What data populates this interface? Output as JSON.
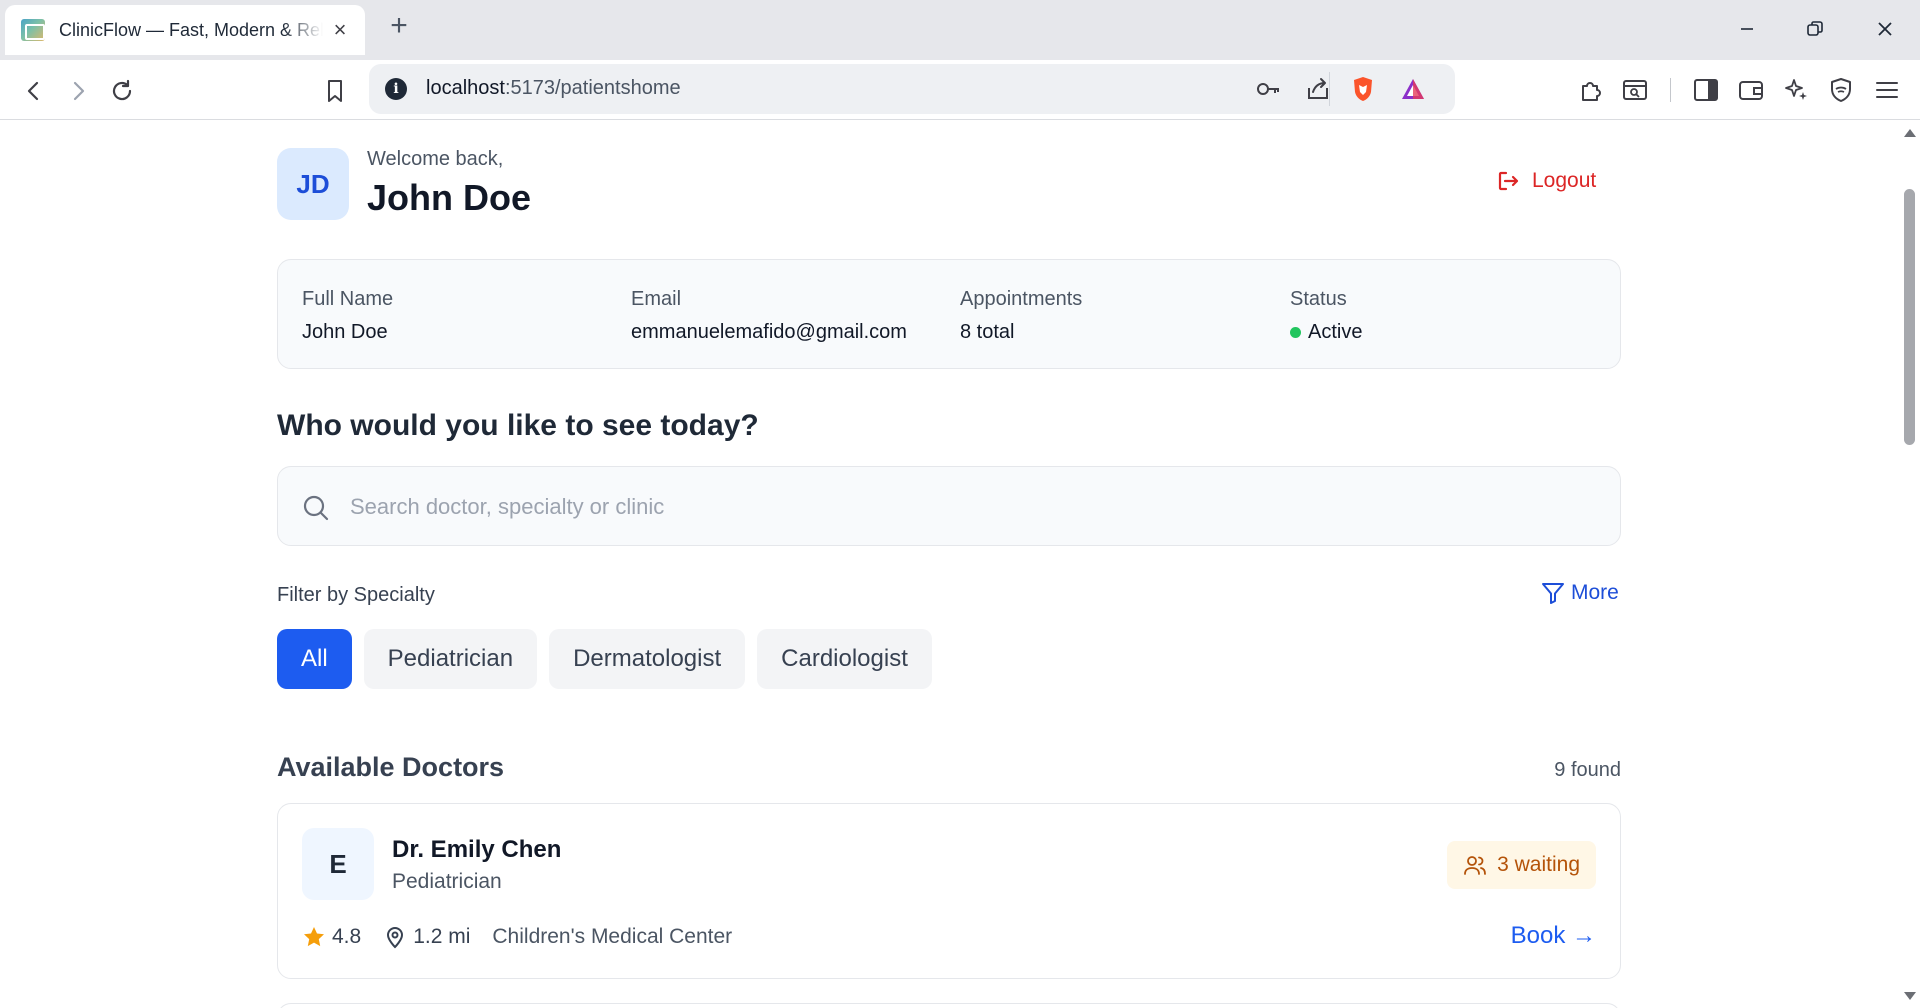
{
  "browser": {
    "tab_title": "ClinicFlow — Fast, Modern & Reliable",
    "url_host": "localhost",
    "url_path": ":5173/patientshome"
  },
  "header": {
    "avatar_initials": "JD",
    "welcome": "Welcome back,",
    "user_name": "John Doe",
    "logout_label": "Logout"
  },
  "profile": {
    "full_name_label": "Full Name",
    "full_name": "John Doe",
    "email_label": "Email",
    "email": "emmanuelemafido@gmail.com",
    "appointments_label": "Appointments",
    "appointments": "8 total",
    "status_label": "Status",
    "status": "Active"
  },
  "search": {
    "heading": "Who would you like to see today?",
    "placeholder": "Search doctor, specialty or clinic"
  },
  "filter": {
    "label": "Filter by Specialty",
    "more_label": "More",
    "chips": [
      "All",
      "Pediatrician",
      "Dermatologist",
      "Cardiologist"
    ],
    "active": "All"
  },
  "doctors": {
    "title": "Available Doctors",
    "found": "9 found",
    "items": [
      {
        "initial": "E",
        "name": "Dr. Emily Chen",
        "specialty": "Pediatrician",
        "waiting": "3 waiting",
        "rating": "4.8",
        "distance": "1.2 mi",
        "clinic": "Children's Medical Center",
        "book_label": "Book →"
      }
    ]
  },
  "colors": {
    "accent": "#1d5cf0",
    "logout": "#dc2626",
    "status_active": "#22c55e",
    "waiting_bg": "#fff7e6",
    "waiting_text": "#b45309",
    "star": "#f59e0b"
  }
}
